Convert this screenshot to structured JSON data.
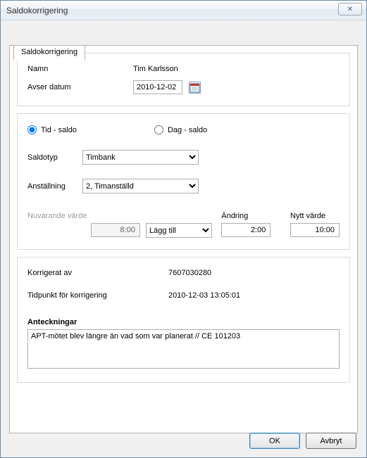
{
  "window": {
    "title": "Saldokorrigering",
    "close_glyph": "✕"
  },
  "tab": {
    "label": "Saldokorrigering"
  },
  "section1": {
    "name_label": "Namn",
    "name_value": "Tim Karlsson",
    "date_label": "Avser datum",
    "date_value": "2010-12-02"
  },
  "section2": {
    "radio_tid": "Tid - saldo",
    "radio_dag": "Dag - saldo",
    "radio_selected": "tid",
    "saldotyp_label": "Saldotyp",
    "saldotyp_value": "Timbank",
    "anstallning_label": "Anställning",
    "anstallning_value": "2, Timanställd",
    "current_label": "Nuvarande värde",
    "current_value": "8:00",
    "op_value": "Lägg till",
    "change_label": "Ändring",
    "change_value": "2:00",
    "new_label": "Nytt värde",
    "new_value": "10:00"
  },
  "section3": {
    "korrigerat_label": "Korrigerat av",
    "korrigerat_value": "7607030280",
    "tidpunkt_label": "Tidpunkt för korrigering",
    "tidpunkt_value": "2010-12-03 13:05:01",
    "notes_label": "Anteckningar",
    "notes_value": "APT-mötet blev längre än vad som var planerat // CE 101203"
  },
  "buttons": {
    "ok": "OK",
    "cancel": "Avbryt"
  }
}
